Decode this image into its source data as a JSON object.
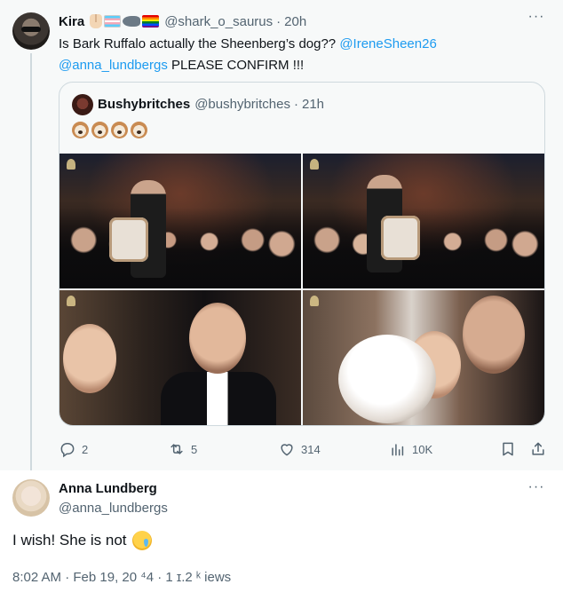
{
  "tweet1": {
    "name": "Kira",
    "handle": "@shark_o_saurus",
    "separator": "·",
    "time": "20h",
    "text_part1": "Is Bark Ruffalo actually the Sheenberg’s dog?? ",
    "mention1": "@IreneSheen26",
    "mention2": "@anna_lundbergs",
    "text_part2": " PLEASE CONFIRM !!!",
    "emojis": [
      "vulcan-salute",
      "transgender-flag",
      "shark",
      "rainbow-flag"
    ],
    "quote": {
      "name": "Bushybritches",
      "handle": "@bushybritches",
      "separator": "·",
      "time": "21h",
      "emojis": [
        "dog-face",
        "dog-face",
        "dog-face",
        "dog-face"
      ]
    },
    "actions": {
      "replies": "2",
      "retweets": "5",
      "likes": "314",
      "views": "10K"
    }
  },
  "tweet2": {
    "name": "Anna Lundberg",
    "handle": "@anna_lundbergs",
    "text": "I wish! She is not",
    "text_emoji": "crying-face",
    "meta": "8:02 AM · Feb 19, 20 ⁴4 · 1 ɪ.2 ᵏ iews"
  },
  "colors": {
    "accent": "#1d9bf0",
    "secondary_text": "#536471",
    "primary_text": "#0f1419",
    "highlight_bg": "#f7f9f9",
    "border": "#cfd9de"
  }
}
